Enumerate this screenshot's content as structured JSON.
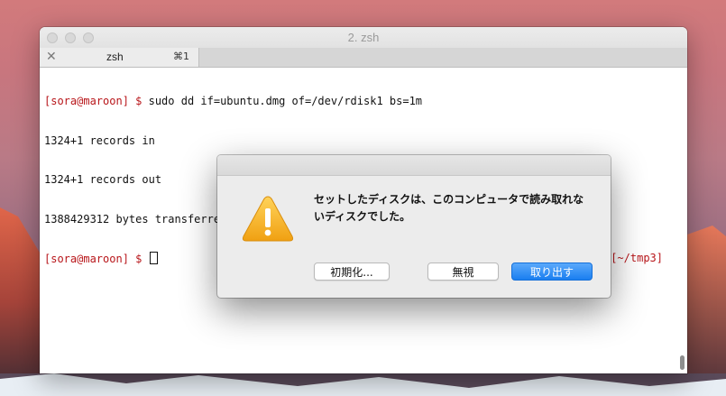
{
  "window": {
    "title": "2. zsh",
    "tab": {
      "label": "zsh",
      "shortcut": "⌘1",
      "close_glyph": "✕"
    }
  },
  "terminal": {
    "lines": [
      {
        "prompt": "[sora@maroon] $ ",
        "text": "sudo dd if=ubuntu.dmg of=/dev/rdisk1 bs=1m"
      },
      {
        "prompt": "",
        "text": "1324+1 records in"
      },
      {
        "prompt": "",
        "text": "1324+1 records out"
      },
      {
        "prompt": "",
        "text": "1388429312 bytes transferred in 283.370190 secs (4899701 bytes/sec)"
      },
      {
        "prompt": "[sora@maroon] $ ",
        "text": ""
      }
    ],
    "right_prompt": "[~/tmp3]"
  },
  "dialog": {
    "icon": "warning-icon",
    "message_line1": "セットしたディスクは、このコンピュータで読み取れな",
    "message_line2": "いディスクでした。",
    "buttons": {
      "initialize": "初期化...",
      "ignore": "無視",
      "eject": "取り出す"
    }
  },
  "colors": {
    "prompt": "#b8161a",
    "primary_button": "#1a7ef0",
    "warning": "#f5b21a"
  }
}
